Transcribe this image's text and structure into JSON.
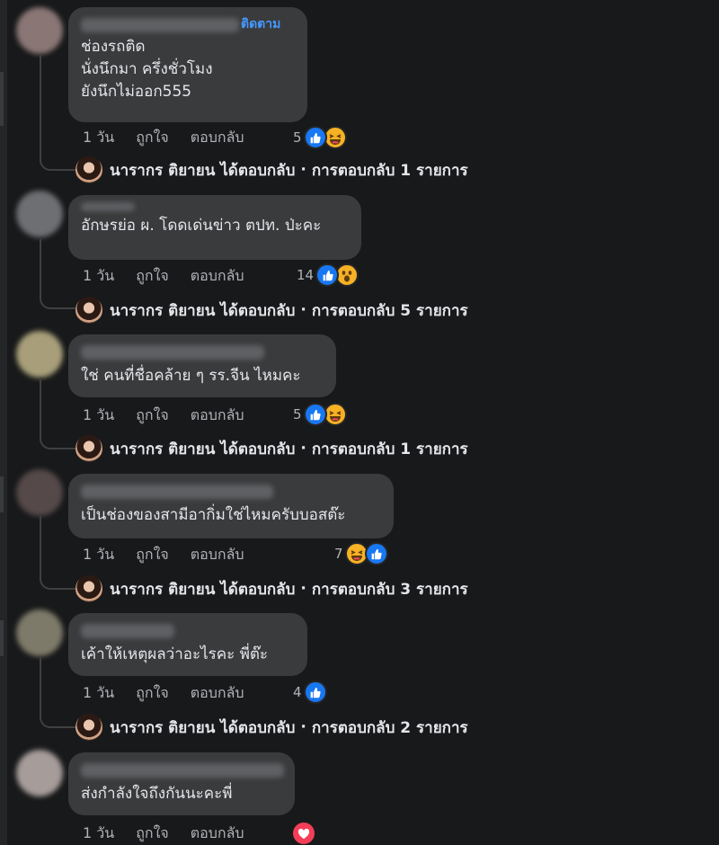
{
  "labels": {
    "like": "ถูกใจ",
    "reply": "ตอบกลับ",
    "follow": "ติดตาม",
    "separator": "·"
  },
  "colors": {
    "background": "#18191a",
    "bubble": "#3a3b3c",
    "link_blue": "#4599ff",
    "like_blue": "#1877f2",
    "love_red": "#f33e58",
    "haha_yellow": "#f7b125"
  },
  "comments": [
    {
      "text": "ช่องรถติด\nนั่งนึกมา ครึ่งชั่วโมง\nยังนึกไม่ออก555",
      "time": "1 วัน",
      "reaction_count": "5",
      "reactions": [
        "like-icon",
        "haha-icon"
      ],
      "reply_author": "นารากร ติยายน",
      "reply_summary": "ได้ตอบกลับ",
      "reply_count": "การตอบกลับ 1 รายการ"
    },
    {
      "text": "อักษรย่อ ผ. โดดเด่นข่าว ตปท. ป่ะคะ",
      "time": "1 วัน",
      "reaction_count": "14",
      "reactions": [
        "like-icon",
        "wow-icon"
      ],
      "reply_author": "นารากร ติยายน",
      "reply_summary": "ได้ตอบกลับ",
      "reply_count": "การตอบกลับ 5 รายการ"
    },
    {
      "text": "ใช่ คนที่ชื่อคล้าย ๆ รร.จีน ไหมคะ",
      "time": "1 วัน",
      "reaction_count": "5",
      "reactions": [
        "like-icon",
        "haha-icon"
      ],
      "reply_author": "นารากร ติยายน",
      "reply_summary": "ได้ตอบกลับ",
      "reply_count": "การตอบกลับ 1 รายการ"
    },
    {
      "text": "เป็นช่องของสามีอากิ่มใช่ไหมครับบอสต๊ะ",
      "time": "1 วัน",
      "reaction_count": "7",
      "reactions": [
        "haha-icon",
        "like-icon"
      ],
      "reply_author": "นารากร ติยายน",
      "reply_summary": "ได้ตอบกลับ",
      "reply_count": "การตอบกลับ 3 รายการ"
    },
    {
      "text": "เค้าให้เหตุผลว่าอะไรคะ พี่ต๊ะ",
      "time": "1 วัน",
      "reaction_count": "4",
      "reactions": [
        "like-icon"
      ],
      "reply_author": "นารากร ติยายน",
      "reply_summary": "ได้ตอบกลับ",
      "reply_count": "การตอบกลับ 2 รายการ"
    },
    {
      "text": "ส่งกำลังใจถึงกันนะคะพี่",
      "time": "1 วัน",
      "reaction_count": "",
      "reactions": [
        "love-icon"
      ]
    }
  ]
}
